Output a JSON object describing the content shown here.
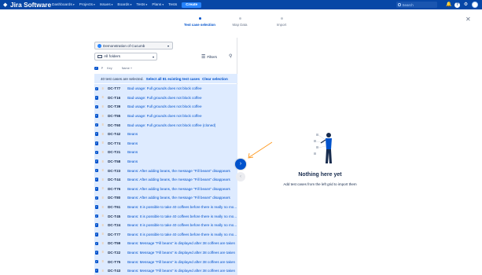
{
  "nav": {
    "logo_text": "Jira Software",
    "items": [
      "Dashboards",
      "Projects",
      "Issues",
      "Boards",
      "Tests",
      "Plans",
      "Tests"
    ],
    "create_label": "Create",
    "search_placeholder": "Search"
  },
  "stepper": {
    "steps": [
      {
        "label": "Test case selection",
        "active": true
      },
      {
        "label": "Map Data",
        "active": false
      },
      {
        "label": "Import",
        "active": false
      }
    ]
  },
  "filters": {
    "project": "Demonstration of Cucumb",
    "folder": "All folders",
    "filters_label": "Filters"
  },
  "table": {
    "headers": {
      "p": "P",
      "key": "Key",
      "name": "Name"
    },
    "selection_text": "40 test cases are selected.",
    "select_all_label": "Select all 81 existing test cases",
    "clear_label": "Clear selection",
    "rows": [
      {
        "key": "DC-T77",
        "name": "Bad usage: Full grounds does not block coffee"
      },
      {
        "key": "DC-T16",
        "name": "Bad usage: Full grounds does not block coffee"
      },
      {
        "key": "DC-T39",
        "name": "Bad usage: Full grounds does not block coffee"
      },
      {
        "key": "DC-T55",
        "name": "Bad usage: Full grounds does not block coffee"
      },
      {
        "key": "DC-T60",
        "name": "Bad usage: Full grounds does not block coffee (cloned)"
      },
      {
        "key": "DC-T42",
        "name": "Beans"
      },
      {
        "key": "DC-T74",
        "name": "Beans"
      },
      {
        "key": "DC-T21",
        "name": "Beans"
      },
      {
        "key": "DC-T58",
        "name": "Beans"
      },
      {
        "key": "DC-T23",
        "name": "Beans: After adding beans, the message \"Fill beans\" disappears"
      },
      {
        "key": "DC-T44",
        "name": "Beans: After adding beans, the message \"Fill beans\" disappears"
      },
      {
        "key": "DC-T76",
        "name": "Beans: After adding beans, the message \"Fill beans\" disappears"
      },
      {
        "key": "DC-T80",
        "name": "Beans: After adding beans, the message \"Fill beans\" disappears"
      },
      {
        "key": "DC-T61",
        "name": "Beans: It is possible to take 40 coffees before there is really no mo..."
      },
      {
        "key": "DC-T45",
        "name": "Beans: It is possible to take 40 coffees before there is really no mo..."
      },
      {
        "key": "DC-T24",
        "name": "Beans: It is possible to take 40 coffees before there is really no mo..."
      },
      {
        "key": "DC-T77",
        "name": "Beans: It is possible to take 40 coffees before there is really no mo..."
      },
      {
        "key": "DC-T59",
        "name": "Beans: Message \"Fill beans\" is displayed after 38 coffees are taken"
      },
      {
        "key": "DC-T22",
        "name": "Beans: Message \"Fill beans\" is displayed after 38 coffees are taken"
      },
      {
        "key": "DC-T75",
        "name": "Beans: Message \"Fill beans\" is displayed after 38 coffees are taken"
      },
      {
        "key": "DC-T43",
        "name": "Beans: Message \"Fill beans\" is displayed after 38 coffees are taken"
      }
    ]
  },
  "empty_state": {
    "title": "Nothing here yet",
    "subtitle": "Add test cases from the left grid to import them"
  },
  "colors": {
    "nav": "#0747a6",
    "accent": "#0052cc",
    "selection": "#deebff",
    "arrow": "#ff991f"
  }
}
